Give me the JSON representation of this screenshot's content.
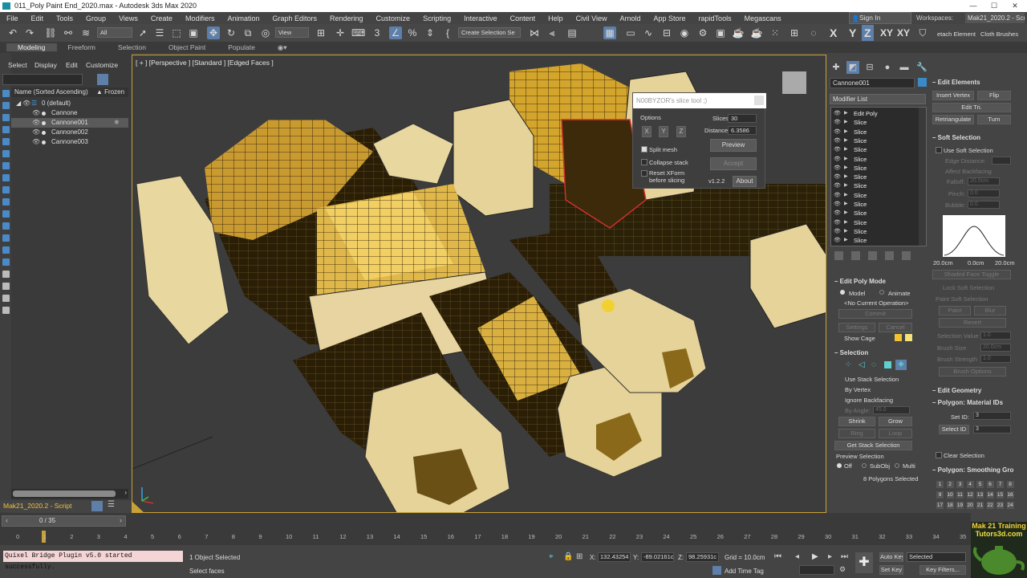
{
  "window": {
    "title": "011_Poly Paint End_2020.max - Autodesk 3ds Max 2020"
  },
  "menu": [
    "File",
    "Edit",
    "Tools",
    "Group",
    "Views",
    "Create",
    "Modifiers",
    "Animation",
    "Graph Editors",
    "Rendering",
    "Customize",
    "Scripting",
    "Interactive",
    "Content",
    "Help",
    "Civil View",
    "Arnold",
    "App Store",
    "rapidTools",
    "Megascans"
  ],
  "signin": "Sign In",
  "workspace": {
    "label": "Workspaces:",
    "value": "Mak21_2020.2 - Script"
  },
  "toolbar": {
    "filter": "All",
    "refcoord": "View",
    "create_selection_set": "Create Selection Se",
    "axes": [
      "X",
      "Y",
      "Z",
      "XY",
      "XY"
    ],
    "extra_right": [
      "etach Element",
      "Cloth Brushes"
    ]
  },
  "ribbon": [
    "Modeling",
    "Freeform",
    "Selection",
    "Object Paint",
    "Populate"
  ],
  "scene_explorer": {
    "tabs": [
      "Select",
      "Display",
      "Edit",
      "Customize"
    ],
    "column_name": "Name (Sorted Ascending)",
    "column_frozen": "▲ Frozen",
    "layer": "0 (default)",
    "objects": [
      "Cannone",
      "Cannone001",
      "Cannone002",
      "Cannone003"
    ],
    "selected": "Cannone001"
  },
  "workspace_bottom": "Mak21_2020.2 - Script",
  "viewport": {
    "label": "[ + ] [Perspective ] [Standard ] [Edged Faces ]"
  },
  "slice_tool": {
    "title": "N00BYZOR's slice tool ;)",
    "options_label": "Options",
    "axis_buttons": [
      "X",
      "Y",
      "Z"
    ],
    "split_mesh": "Split mesh",
    "collapse_stack": "Collapse stack",
    "reset_xform": "Reset XForm",
    "reset_xform2": "before slicing",
    "slices_label": "Slices",
    "slices_value": "30",
    "distance_label": "Distance",
    "distance_value": "6.3586",
    "preview": "Preview",
    "accept": "Accept",
    "version": "v1.2.2",
    "about": "About"
  },
  "command_panel": {
    "object_name": "Cannone001",
    "modifier_list": "Modifier List",
    "stack": [
      "Edit Poly",
      "Slice",
      "Slice",
      "Slice",
      "Slice",
      "Slice",
      "Slice",
      "Slice",
      "Slice",
      "Slice",
      "Slice",
      "Slice",
      "Slice",
      "Slice",
      "Slice"
    ],
    "edit_poly_mode": {
      "title": "Edit Poly Mode",
      "model": "Model",
      "animate": "Animate",
      "current_op": "<No Current Operation>",
      "commit": "Commit",
      "settings": "Settings",
      "cancel": "Cancel",
      "show_cage": "Show Cage"
    },
    "selection": {
      "title": "Selection",
      "use_stack": "Use Stack Selection",
      "by_vertex": "By Vertex",
      "ignore_backfacing": "Ignore Backfacing",
      "by_angle": "By Angle:",
      "by_angle_value": "45.0",
      "shrink": "Shrink",
      "grow": "Grow",
      "ring": "Ring",
      "loop": "Loop",
      "get_stack": "Get Stack Selection",
      "preview_selection": "Preview Selection",
      "off": "Off",
      "subobj": "SubObj",
      "multi": "Multi",
      "status": "8 Polygons Selected"
    },
    "edit_elements": {
      "title": "Edit Elements",
      "insert_vertex": "Insert Vertex",
      "flip": "Flip",
      "edit_tri": "Edit Tri.",
      "retriangulate": "Retriangulate",
      "turn": "Turn"
    },
    "soft_selection": {
      "title": "Soft Selection",
      "use_soft": "Use Soft Selection",
      "edge_distance": "Edge Distance:",
      "affect_backfacing": "Affect Backfacing",
      "falloff": "Falloff:",
      "falloff_value": "20.0cm",
      "pinch": "Pinch:",
      "pinch_value": "0.0",
      "bubble": "Bubble:",
      "bubble_value": "0.0",
      "curve_labels": [
        "20.0cm",
        "0.0cm",
        "20.0cm"
      ],
      "shaded_face_toggle": "Shaded Face Toggle",
      "lock_soft": "Lock Soft Selection",
      "paint_soft": "Paint Soft Selection",
      "paint": "Paint",
      "blur": "Blur",
      "revert": "Revert",
      "selection_value": "Selection Value",
      "selection_value_v": "1.0",
      "brush_size": "Brush Size",
      "brush_size_v": "20.0cm",
      "brush_strength": "Brush Strength",
      "brush_strength_v": "1.0",
      "brush_options": "Brush Options"
    },
    "edit_geometry": {
      "title": "Edit Geometry"
    },
    "material_ids": {
      "title": "Polygon: Material IDs",
      "set_id": "Set ID:",
      "set_id_v": "3",
      "select_id": "Select ID",
      "select_id_v": "3",
      "clear_selection": "Clear Selection"
    },
    "smoothing": {
      "title": "Polygon: Smoothing Gro",
      "groups": [
        "1",
        "2",
        "3",
        "4",
        "5",
        "6",
        "7",
        "8",
        "9",
        "10",
        "11",
        "12",
        "13",
        "14",
        "15",
        "16",
        "17",
        "18",
        "19",
        "20",
        "21",
        "22",
        "23",
        "24"
      ]
    }
  },
  "timeline": {
    "frame": "0 / 35",
    "ticks": [
      "0",
      "1",
      "2",
      "3",
      "4",
      "5",
      "6",
      "7",
      "8",
      "9",
      "10",
      "11",
      "12",
      "13",
      "14",
      "15",
      "16",
      "17",
      "18",
      "19",
      "20",
      "21",
      "22",
      "23",
      "24",
      "25",
      "26",
      "27",
      "28",
      "29",
      "30",
      "31",
      "32",
      "33",
      "34",
      "35"
    ]
  },
  "status": {
    "listener": "Quixel Bridge Plugin v5.0 started successfully.",
    "selected": "1 Object Selected",
    "prompt": "Select faces",
    "x": "132.43254",
    "y": "-89.02161c",
    "z": "98.25931c",
    "grid": "Grid = 10.0cm",
    "add_time_tag": "Add Time Tag",
    "auto_key": "Auto Key",
    "set_key": "Set Key",
    "selected_dd": "Selected",
    "key_filters": "Key Filters..."
  },
  "watermark": {
    "line1": "Mak 21 Training",
    "line2": "Tutors3d.com"
  }
}
